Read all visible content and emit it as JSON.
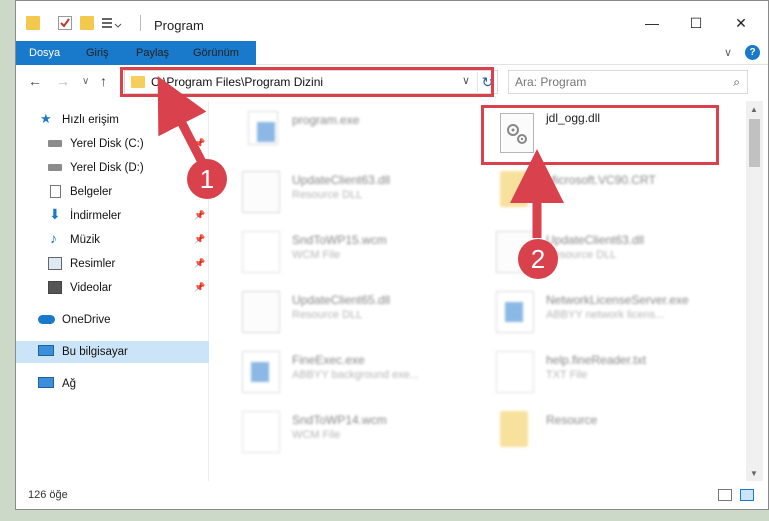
{
  "titlebar": {
    "title": "Program",
    "minimize": "—",
    "maximize": "☐",
    "close": "✕"
  },
  "ribbon": {
    "tabs": [
      "Dosya",
      "Giriş",
      "Paylaş",
      "Görünüm"
    ],
    "chevron": "∨",
    "help": "?"
  },
  "navbar": {
    "back": "←",
    "forward": "→",
    "recent": "∨",
    "up": "↑",
    "address": "C:\\Program Files\\Program Dizini",
    "address_dropdown": "∨",
    "refresh": "↻",
    "search_placeholder": "Ara: Program",
    "search_glyph": "⌕"
  },
  "sidebar": {
    "items": [
      {
        "label": "Hızlı erişim",
        "icon": "star-icon",
        "pinned": false,
        "selected": false
      },
      {
        "label": "Yerel Disk (C:)",
        "icon": "drive-icon",
        "pinned": true,
        "selected": false
      },
      {
        "label": "Yerel Disk (D:)",
        "icon": "drive-icon",
        "pinned": false,
        "selected": false
      },
      {
        "label": "Belgeler",
        "icon": "documents-icon",
        "pinned": false,
        "selected": false
      },
      {
        "label": "İndirmeler",
        "icon": "download-icon",
        "pinned": true,
        "selected": false
      },
      {
        "label": "Müzik",
        "icon": "music-icon",
        "pinned": true,
        "selected": false
      },
      {
        "label": "Resimler",
        "icon": "pictures-icon",
        "pinned": true,
        "selected": false
      },
      {
        "label": "Videolar",
        "icon": "videos-icon",
        "pinned": true,
        "selected": false
      },
      {
        "label": "OneDrive",
        "icon": "cloud-icon",
        "pinned": false,
        "selected": false
      },
      {
        "label": "Bu bilgisayar",
        "icon": "computer-icon",
        "pinned": false,
        "selected": true
      },
      {
        "label": "Ağ",
        "icon": "network-icon",
        "pinned": false,
        "selected": false
      }
    ],
    "pin_glyph": "📌"
  },
  "files": {
    "program_exe": {
      "name": "program.exe",
      "type": ""
    },
    "jdl_ogg": {
      "name": "jdl_ogg.dll",
      "type": ""
    },
    "update63a": {
      "name": "UpdateClient63.dll",
      "type": "Resource DLL"
    },
    "vc90": {
      "name": "Microsoft.VC90.CRT",
      "type": ""
    },
    "sndwp15": {
      "name": "SndToWP15.wcm",
      "type": "WCM File"
    },
    "update63b": {
      "name": "UpdateClient63.dll",
      "type": "Resource DLL"
    },
    "update65": {
      "name": "UpdateClient65.dll",
      "type": "Resource DLL"
    },
    "netlic": {
      "name": "NetworkLicenseServer.exe",
      "type": "ABBYY network licens..."
    },
    "fineexec": {
      "name": "FineExec.exe",
      "type": "ABBYY background exe..."
    },
    "helptxt": {
      "name": "help.fineReader.txt",
      "type": "TXT File"
    },
    "sndwp14": {
      "name": "SndToWP14.wcm",
      "type": "WCM File"
    },
    "resource": {
      "name": "Resource",
      "type": ""
    }
  },
  "statusbar": {
    "item_count": "126 öğe"
  },
  "annotations": {
    "step1": "1",
    "step2": "2",
    "color": "#d9414d"
  },
  "colors": {
    "accent": "#1979ca",
    "selected_bg": "#cce4f7",
    "folder": "#f3c94d"
  }
}
